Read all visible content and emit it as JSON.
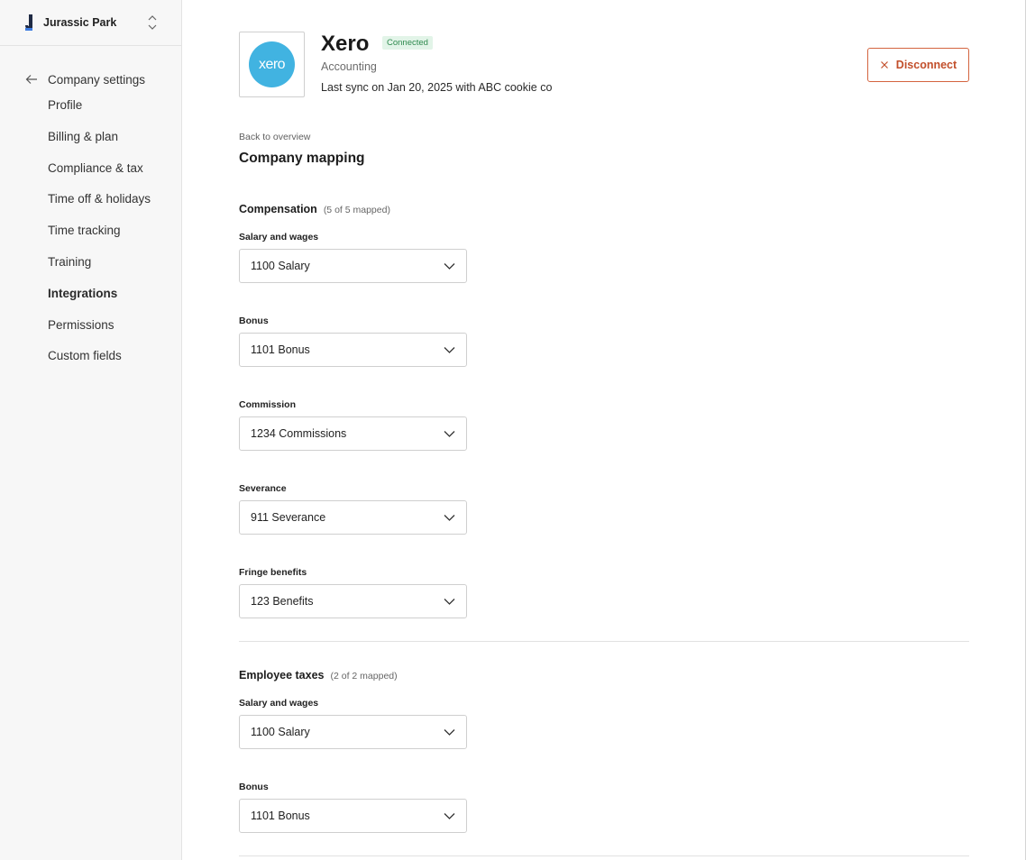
{
  "workspace": {
    "name": "Jurassic Park"
  },
  "sidebar": {
    "back_label": "Company settings",
    "items": [
      {
        "label": "Profile",
        "active": false
      },
      {
        "label": "Billing & plan",
        "active": false
      },
      {
        "label": "Compliance & tax",
        "active": false
      },
      {
        "label": "Time off & holidays",
        "active": false
      },
      {
        "label": "Time tracking",
        "active": false
      },
      {
        "label": "Training",
        "active": false
      },
      {
        "label": "Integrations",
        "active": true
      },
      {
        "label": "Permissions",
        "active": false
      },
      {
        "label": "Custom fields",
        "active": false
      }
    ]
  },
  "app": {
    "logo_text": "xero",
    "title": "Xero",
    "status": "Connected",
    "category": "Accounting",
    "sync": "Last sync on Jan 20, 2025 with ABC cookie co",
    "disconnect_label": "Disconnect"
  },
  "colors": {
    "accent": "#c24f2b",
    "xero_blue": "#41b3e1",
    "connected_green": "#2f8a4f"
  },
  "content": {
    "back_link": "Back to overview",
    "title": "Company mapping",
    "sections": [
      {
        "title": "Compensation",
        "count": "(5 of 5 mapped)",
        "fields": [
          {
            "label": "Salary and wages",
            "value": "1100 Salary"
          },
          {
            "label": "Bonus",
            "value": "1101 Bonus"
          },
          {
            "label": "Commission",
            "value": "1234 Commissions"
          },
          {
            "label": "Severance",
            "value": "911 Severance"
          },
          {
            "label": "Fringe benefits",
            "value": "123 Benefits"
          }
        ]
      },
      {
        "title": "Employee taxes",
        "count": "(2 of 2 mapped)",
        "fields": [
          {
            "label": "Salary and wages",
            "value": "1100 Salary"
          },
          {
            "label": "Bonus",
            "value": "1101 Bonus"
          }
        ]
      }
    ]
  }
}
